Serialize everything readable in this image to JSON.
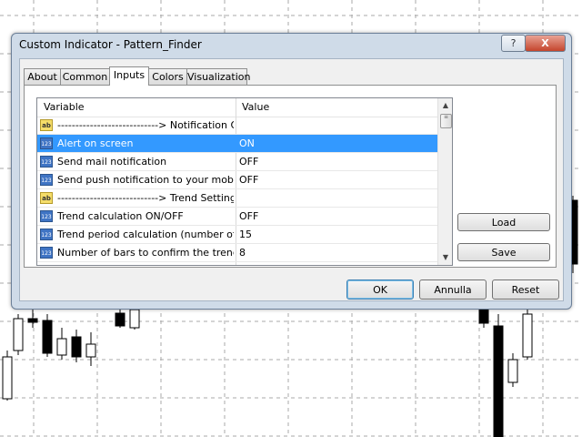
{
  "window": {
    "title": "Custom Indicator - Pattern_Finder",
    "help_glyph": "?",
    "close_glyph": "X"
  },
  "tabs": [
    {
      "label": "About"
    },
    {
      "label": "Common"
    },
    {
      "label": "Inputs",
      "active": true
    },
    {
      "label": "Colors"
    },
    {
      "label": "Visualization"
    }
  ],
  "grid": {
    "columns": {
      "variable": "Variable",
      "value": "Value"
    },
    "rows": [
      {
        "icon": "ab-icon",
        "icon_text": "ab",
        "variable": "---------------------------->     Notification Opti...",
        "value": ""
      },
      {
        "icon": "numeric-icon",
        "icon_text": "123",
        "variable": "Alert on screen",
        "value": "ON",
        "selected": true
      },
      {
        "icon": "numeric-icon",
        "icon_text": "123",
        "variable": "Send mail notification",
        "value": "OFF"
      },
      {
        "icon": "numeric-icon",
        "icon_text": "123",
        "variable": "Send push notification to your mobile",
        "value": "OFF"
      },
      {
        "icon": "ab-icon",
        "icon_text": "ab",
        "variable": "---------------------------->     Trend Settings",
        "value": ""
      },
      {
        "icon": "numeric-icon",
        "icon_text": "123",
        "variable": "Trend calculation ON/OFF",
        "value": "OFF"
      },
      {
        "icon": "numeric-icon",
        "icon_text": "123",
        "variable": "Trend period calculation (number of bars)",
        "value": "15"
      },
      {
        "icon": "numeric-icon",
        "icon_text": "123",
        "variable": "Number of bars to confirm the trend bef...",
        "value": "8"
      }
    ]
  },
  "side_buttons": {
    "load": "Load",
    "save": "Save"
  },
  "bottom_buttons": {
    "ok": "OK",
    "cancel": "Annulla",
    "reset": "Reset"
  },
  "scroll": {
    "up": "▲",
    "down": "▼",
    "thumb": "≡"
  }
}
